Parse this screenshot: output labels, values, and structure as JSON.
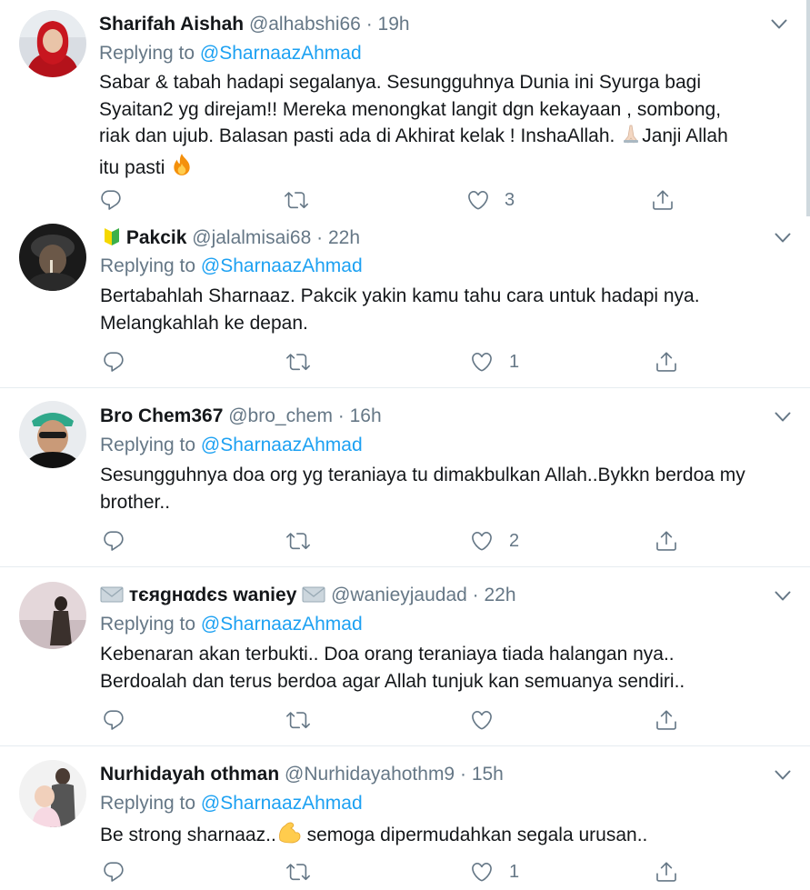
{
  "tweets": [
    {
      "name": "Sharifah Aishah",
      "handle": "@alhabshi66",
      "sep": "·",
      "time": "19h",
      "replying_label": "Replying to",
      "replying_to": "@SharnaazAhmad",
      "lines": [
        "Sabar & tabah hadapi segalanya. Sesungguhnya Dunia ini Syurga bagi",
        "Syaitan2 yg direjam!! Mereka menongkat langit dgn kekayaan , sombong,",
        "riak dan ujub. Balasan pasti ada di Akhirat kelak ! InshaAllah.",
        "Janji Allah",
        "itu pasti"
      ],
      "likes": "3"
    },
    {
      "name": "Pakcik",
      "handle": "@jalalmisai68",
      "sep": "·",
      "time": "22h",
      "replying_label": "Replying to",
      "replying_to": "@SharnaazAhmad",
      "lines": [
        "Bertabahlah Sharnaaz. Pakcik yakin kamu tahu cara untuk hadapi nya.",
        "Melangkahlah ke depan."
      ],
      "likes": "1"
    },
    {
      "name": "Bro Chem367",
      "handle": "@bro_chem",
      "sep": "·",
      "time": "16h",
      "replying_label": "Replying to",
      "replying_to": "@SharnaazAhmad",
      "lines": [
        "Sesungguhnya doa org yg teraniaya tu dimakbulkan Allah..Bykkn berdoa my",
        "brother.."
      ],
      "likes": "2"
    },
    {
      "name": "тєяgнαdєs waniey",
      "handle": "@wanieyjaudad",
      "sep": "·",
      "time": "22h",
      "replying_label": "Replying to",
      "replying_to": "@SharnaazAhmad",
      "lines": [
        "Kebenaran akan terbukti.. Doa orang teraniaya tiada halangan nya..",
        "Berdoalah dan terus berdoa agar Allah tunjuk kan semuanya sendiri.."
      ],
      "likes": ""
    },
    {
      "name": "Nurhidayah othman",
      "handle": "@Nurhidayahothm9",
      "sep": "·",
      "time": "15h",
      "replying_label": "Replying to",
      "replying_to": "@SharnaazAhmad",
      "lines": [
        "Be strong sharnaaz..",
        "semoga dipermudahkan segala urusan.."
      ],
      "likes": "1"
    }
  ],
  "icons": {
    "reply": "reply-icon",
    "retweet": "retweet-icon",
    "like": "heart-icon",
    "share": "share-icon",
    "more": "chevron-down-icon"
  },
  "colors": {
    "accent": "#1da1f2",
    "muted": "#657786",
    "text": "#14171a",
    "divider": "#e6ecf0"
  }
}
